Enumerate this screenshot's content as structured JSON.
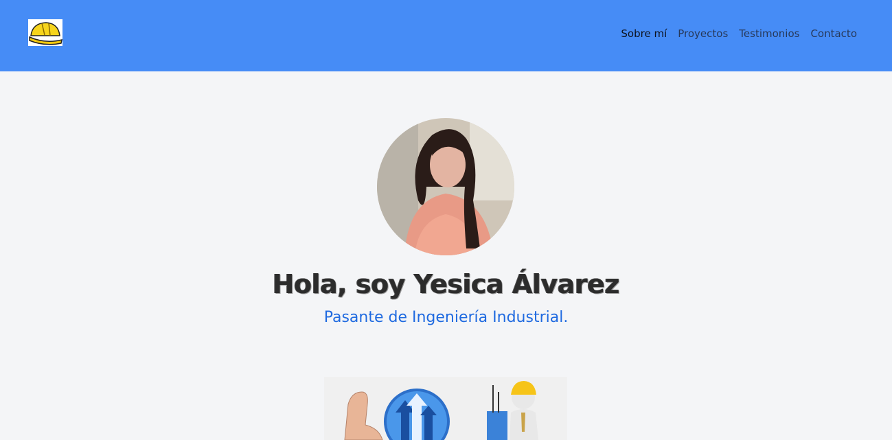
{
  "nav": {
    "logo_icon": "hard-hat-icon",
    "links": [
      {
        "label": "Sobre mí",
        "active": true
      },
      {
        "label": "Proyectos",
        "active": false
      },
      {
        "label": "Testimonios",
        "active": false
      },
      {
        "label": "Contacto",
        "active": false
      }
    ]
  },
  "hero": {
    "title": "Hola, soy Yesica Álvarez",
    "subtitle": "Pasante de Ingeniería Industrial."
  },
  "colors": {
    "navbar": "#468cf6",
    "background": "#f4f5f7",
    "subtitle": "#1f6ae0"
  }
}
